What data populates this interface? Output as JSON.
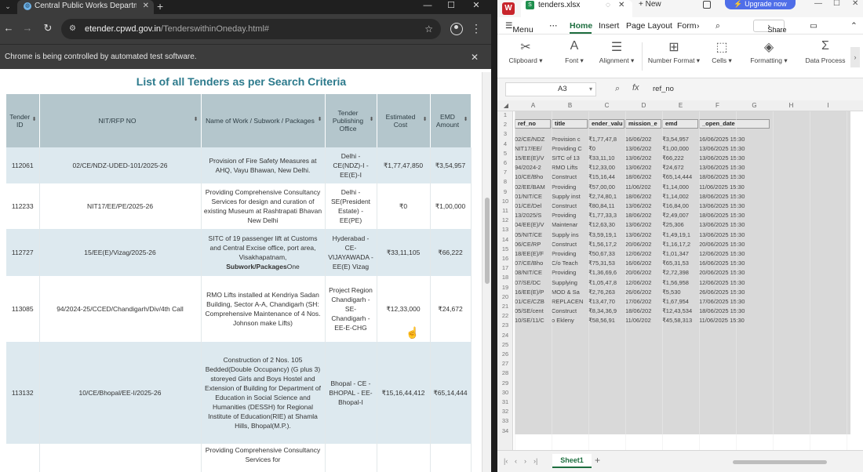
{
  "chrome": {
    "tab_title": "Central Public Works Departme",
    "url_host": "etender.cpwd.gov.in",
    "url_path": "/TenderswithinOneday.html#",
    "infobar_text": "Chrome is being controlled by automated test software.",
    "page_heading": "List of all Tenders as per Search Criteria",
    "columns": [
      "Tender ID",
      "NIT/RFP NO",
      "Name of Work / Subwork / Packages",
      "Tender Publishing Office",
      "Estimated Cost",
      "EMD Amount"
    ],
    "rows": [
      {
        "id": "112061",
        "nit": "02/CE/NDZ-UDED-101/2025-26",
        "name": "Provision of Fire Safety Measures at AHQ, Vayu Bhawan, New Delhi.",
        "office": "Delhi - CE(NDZ)-I - EE(E)-I",
        "cost": "₹1,77,47,850",
        "emd": "₹3,54,957"
      },
      {
        "id": "112233",
        "nit": "NIT17/EE/PE/2025-26",
        "name": "Providing Comprehensive Consultancy Services for design and curation of existing Museum at Rashtrapati Bhavan New Delhi",
        "office": "Delhi - SE(President Estate) - EE(PE)",
        "cost": "₹0",
        "emd": "₹1,00,000"
      },
      {
        "id": "112727",
        "nit": "15/EE(E)/Vizag/2025-26",
        "name": "SITC of 19 passenger lift at Customs and Central Excise office, port area, Visakhapatnam,",
        "name_bold": "Subwork/Packages",
        "name_tail": "One",
        "office": "Hyderabad - CE- VIJAYAWADA - EE(E) Vizag",
        "cost": "₹33,11,105",
        "emd": "₹66,222"
      },
      {
        "id": "113085",
        "nit": "94/2024-25/CCED/Chandigarh/Div/4th Call",
        "name": "RMO Lifts installed at Kendriya Sadan Building, Sector A-A, Chandigarh (SH: Comprehensive Maintenance of 4 Nos. Johnson make Lifts)",
        "office": "Project Region Chandigarh - SE- Chandigarh - EE-E-CHG",
        "cost": "₹12,33,000",
        "emd": "₹24,672"
      },
      {
        "id": "113132",
        "nit": "10/CE/Bhopal/EE-I/2025-26",
        "name": "Construction of 2 Nos. 105 Bedded(Double Occupancy) (G plus 3) storeyed Girls and Boys Hostel and Extension of Building for Department of Education in Social Science and Humanities (DESSH) for Regional Institute of Education(RIE) at Shamla Hills, Bhopal(M.P.).",
        "office": "Bhopal - CE - BHOPAL - EE-Bhopal-I",
        "cost": "₹15,16,44,412",
        "emd": "₹65,14,444"
      },
      {
        "id": "",
        "nit": "",
        "name": "Providing Comprehensive Consultancy Services for",
        "office": "",
        "cost": "",
        "emd": ""
      }
    ]
  },
  "sheet": {
    "tab_title": "tenders.xlsx",
    "new_label": "New",
    "upgrade_label": "Upgrade now",
    "menu": [
      "Menu",
      "Home",
      "Insert",
      "Page Layout",
      "Form"
    ],
    "share_label": "Share",
    "ribbon": [
      "Clipboard",
      "Font",
      "Alignment",
      "Number Format",
      "Cells",
      "Formatting",
      "Data Process"
    ],
    "namebox": "A3",
    "formula": "ref_no",
    "col_letters": [
      "A",
      "B",
      "C",
      "D",
      "E",
      "F",
      "G",
      "H",
      "I"
    ],
    "header": [
      "ref_no",
      "title",
      "ender_valu",
      "mission_e",
      "emd",
      "_open_date"
    ],
    "rows": [
      [
        "02/CE/NDZ",
        "Provision c",
        "₹1,77,47,8",
        "16/06/202",
        "₹3,54,957",
        "16/06/2025 15:30"
      ],
      [
        "NIT17/EE/",
        "Providing C",
        "₹0",
        "13/06/202",
        "₹1,00,000",
        "13/06/2025 15:30"
      ],
      [
        "15/EE(E)/V",
        "SITC of 13",
        "₹33,11,10",
        "13/06/202",
        "₹66,222",
        "13/06/2025 15:30"
      ],
      [
        "94/2024-2",
        "RMO Lifts",
        "₹12,33,00",
        "13/06/202",
        "₹24,672",
        "13/06/2025 15:30"
      ],
      [
        "10/CE/Bho",
        "Construct",
        "₹15,16,44",
        "18/06/202",
        "₹65,14,444",
        "18/06/2025 15:30"
      ],
      [
        "02/EE/BAM",
        "Providing",
        "₹57,00,00",
        "11/06/202",
        "₹1,14,000",
        "11/06/2025 15:30"
      ],
      [
        "01/NIT/CE",
        "Supply inst",
        "₹2,74,80,1",
        "18/06/202",
        "₹1,14,002",
        "18/06/2025 15:30"
      ],
      [
        "01/CE/Del",
        "Construct",
        "₹80,84,11",
        "13/06/202",
        "₹16,84,00",
        "13/06/2025 15:30"
      ],
      [
        "13/2025/S",
        "Providing",
        "₹1,77,33,3",
        "18/06/202",
        "₹2,49,007",
        "18/06/2025 15:30"
      ],
      [
        "04/EE(E)/V",
        "Maintenar",
        "₹12,63,30",
        "13/06/202",
        "₹25,306",
        "13/06/2025 15:30"
      ],
      [
        "05/NIT/CE",
        "Supply ins",
        "₹3,59,19,1",
        "13/06/202",
        "₹1,49,19,1",
        "13/06/2025 15:30"
      ],
      [
        "06/CE/RP",
        "Construct",
        "₹1,56,17,2",
        "20/06/202",
        "₹1,16,17,2",
        "20/06/2025 15:30"
      ],
      [
        "18/EE(E)/F",
        "Providing",
        "₹50,67,33",
        "12/06/202",
        "₹1,01,347",
        "12/06/2025 15:30"
      ],
      [
        "07/CE/Bho",
        "C/o Teach",
        "₹75,31,53",
        "16/06/202",
        "₹65,31,53",
        "16/06/2025 15:30"
      ],
      [
        "08/NIT/CE",
        "Providing",
        "₹1,36,69,6",
        "20/06/202",
        "₹2,72,398",
        "20/06/2025 15:30"
      ],
      [
        "07/SE/DC",
        "Supplying",
        "₹1,05,47,8",
        "12/06/202",
        "₹1,56,958",
        "12/06/2025 15:30"
      ],
      [
        "16/EE(E)/P",
        "MOD & Sa",
        "₹2,76,263",
        "26/06/202",
        "₹5,530",
        "26/06/2025 15:30"
      ],
      [
        "01/CE/CZB",
        "REPLACEN",
        "₹13,47,70",
        "17/06/202",
        "₹1,67,954",
        "17/06/2025 15:30"
      ],
      [
        "05/SE/cent",
        "Construct",
        "₹8,34,36,9",
        "18/06/202",
        "₹12,43,534",
        "18/06/2025 15:30"
      ],
      [
        "10/SE/11/C",
        "o Ekleny",
        "₹58,56,91",
        "11/06/202",
        "₹45,58,313",
        "11/06/2025 15:30"
      ]
    ],
    "sheet_tab": "Sheet1"
  },
  "colors": {
    "heading": "#2c7a8c",
    "table_header_bg": "#b4c6cc",
    "row_stripe": "#dde9ef",
    "wps_green": "#1d6e3f",
    "wps_logo_red": "#c8252c",
    "upgrade_blue": "#4f6ee8"
  }
}
